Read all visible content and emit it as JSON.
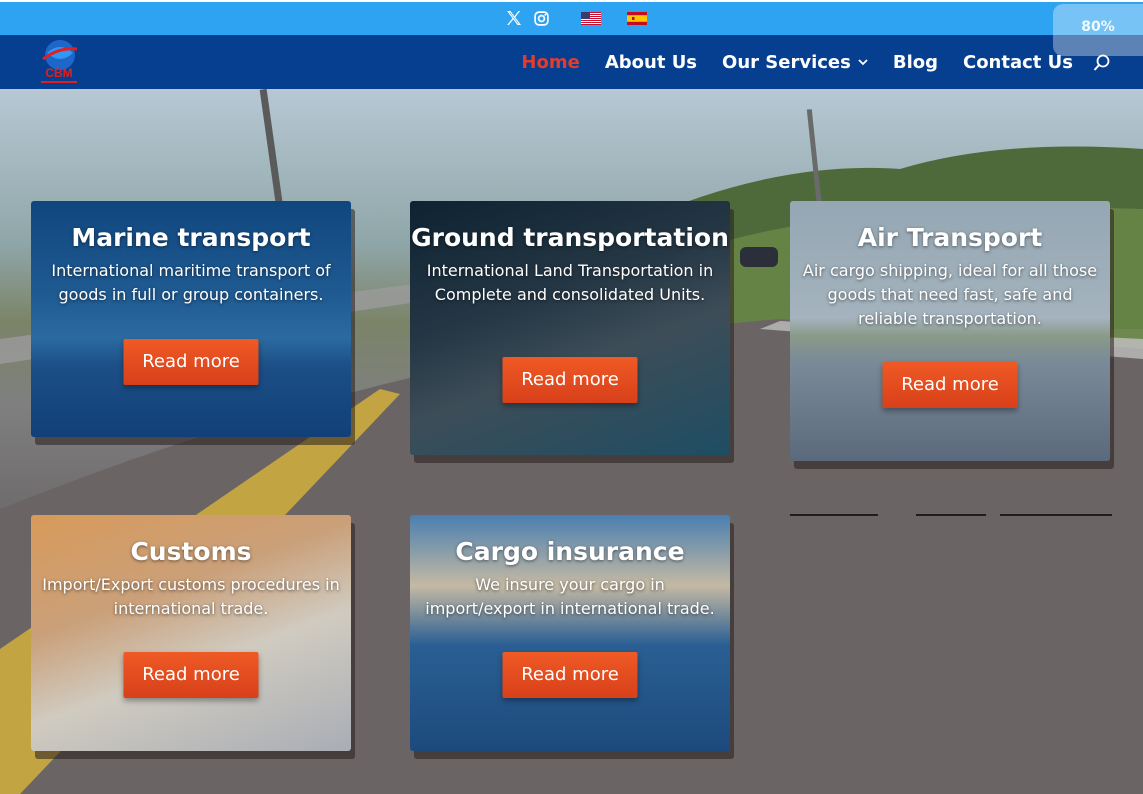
{
  "topbar": {
    "icons": [
      "x-icon",
      "instagram-icon",
      "flag-us-icon",
      "flag-es-icon"
    ],
    "zoom": "80%"
  },
  "navbar": {
    "logo_text": "CBM",
    "items": [
      {
        "label": "Home",
        "active": true
      },
      {
        "label": "About Us"
      },
      {
        "label": "Our Services",
        "has_dropdown": true
      },
      {
        "label": "Blog"
      },
      {
        "label": "Contact Us"
      }
    ],
    "search_icon": "search-icon"
  },
  "cards": [
    {
      "title": "Marine transport",
      "text": "International maritime transport of goods in full or group containers.",
      "button": "Read more"
    },
    {
      "title": "Ground transportation",
      "text": "International Land Transportation in Complete and consolidated Units.",
      "button": "Read more"
    },
    {
      "title": "Air Transport",
      "text": "Air cargo shipping, ideal for all those goods that need fast, safe and reliable transportation.",
      "button": "Read more"
    },
    {
      "title": "Customs",
      "text": "Import/Export customs procedures in international trade.",
      "button": "Read more"
    },
    {
      "title": "Cargo insurance",
      "text": "We insure your cargo in import/export in international trade.",
      "button": "Read more"
    }
  ],
  "colors": {
    "topbar": "#2ea3f2",
    "navbar": "#063f8f",
    "nav_active": "#e53b2c",
    "button": "#e2491f"
  }
}
